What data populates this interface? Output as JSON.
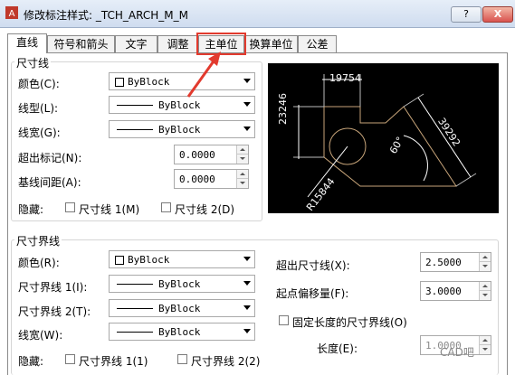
{
  "window": {
    "title": "修改标注样式: _TCH_ARCH_M_M",
    "help_label": "?",
    "close_label": "X"
  },
  "tabs": [
    "直线",
    "符号和箭头",
    "文字",
    "调整",
    "主单位",
    "换算单位",
    "公差"
  ],
  "dim_lines": {
    "legend": "尺寸线",
    "color_label": "颜色(C):",
    "color_value": "ByBlock",
    "linetype_label": "线型(L):",
    "linetype_value": "ByBlock",
    "lineweight_label": "线宽(G):",
    "lineweight_value": "ByBlock",
    "extend_label": "超出标记(N):",
    "extend_value": "0.0000",
    "baseline_label": "基线间距(A):",
    "baseline_value": "0.0000",
    "suppress_label": "隐藏:",
    "suppress1": "尺寸线 1(M)",
    "suppress2": "尺寸线 2(D)"
  },
  "ext_lines": {
    "legend": "尺寸界线",
    "color_label": "颜色(R):",
    "color_value": "ByBlock",
    "linetype1_label": "尺寸界线 1(I):",
    "linetype1_value": "ByBlock",
    "linetype2_label": "尺寸界线 2(T):",
    "linetype2_value": "ByBlock",
    "lineweight_label": "线宽(W):",
    "lineweight_value": "ByBlock",
    "suppress_label": "隐藏:",
    "suppress1": "尺寸界线 1(1)",
    "suppress2": "尺寸界线 2(2)",
    "extend_label": "超出尺寸线(X):",
    "extend_value": "2.5000",
    "offset_label": "起点偏移量(F):",
    "offset_value": "3.0000",
    "fixed_label": "固定长度的尺寸界线(O)",
    "length_label": "长度(E):",
    "length_value": "1.0000"
  },
  "preview": {
    "dim_top": "19754",
    "dim_left": "23246",
    "dim_diag": "39292",
    "dim_radius": "R15844",
    "dim_angle": "60°"
  },
  "watermark": "CAD吧",
  "colors": {
    "annotation": "#e23a2e",
    "preview_bg": "#000000"
  }
}
